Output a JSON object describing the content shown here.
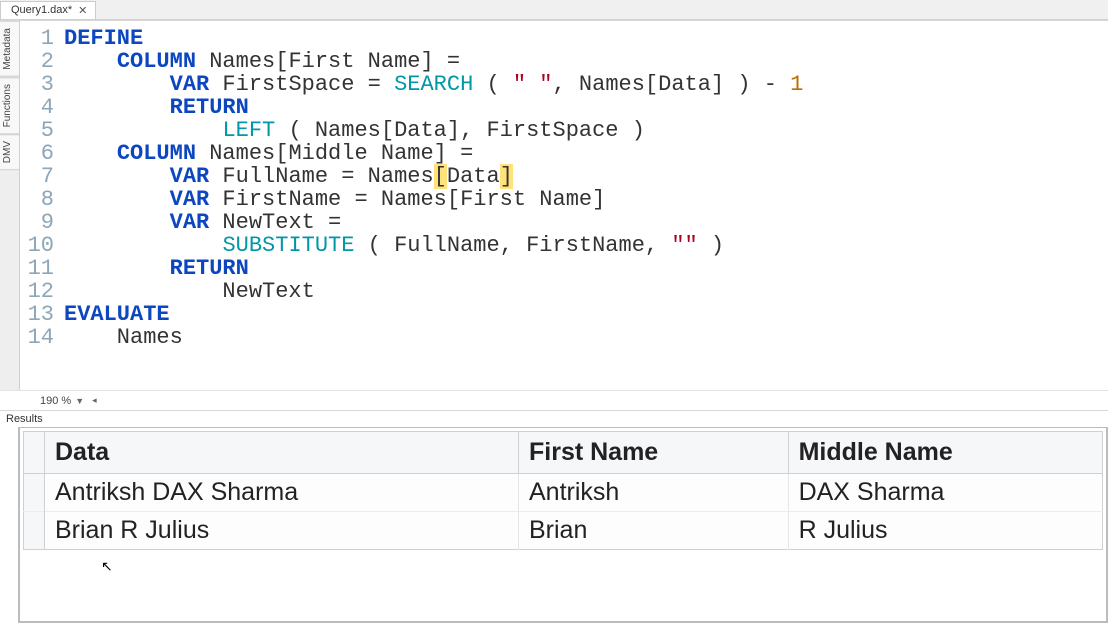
{
  "tab": {
    "label": "Query1.dax*"
  },
  "side_tabs": [
    "Metadata",
    "Functions",
    "DMV"
  ],
  "zoom": "190 %",
  "results_header": "Results",
  "code": {
    "lines": [
      {
        "n": "1",
        "seg": [
          {
            "c": "kw",
            "t": "DEFINE"
          }
        ]
      },
      {
        "n": "2",
        "seg": [
          {
            "t": "    "
          },
          {
            "c": "kw",
            "t": "COLUMN"
          },
          {
            "t": " Names[First Name] ="
          }
        ]
      },
      {
        "n": "3",
        "seg": [
          {
            "t": "        "
          },
          {
            "c": "kw",
            "t": "VAR"
          },
          {
            "t": " FirstSpace = "
          },
          {
            "c": "fn",
            "t": "SEARCH"
          },
          {
            "t": " ( "
          },
          {
            "c": "str",
            "t": "\" \""
          },
          {
            "t": ", Names[Data] ) - "
          },
          {
            "c": "num",
            "t": "1"
          }
        ]
      },
      {
        "n": "4",
        "seg": [
          {
            "t": "        "
          },
          {
            "c": "kw",
            "t": "RETURN"
          }
        ]
      },
      {
        "n": "5",
        "seg": [
          {
            "t": "            "
          },
          {
            "c": "fn",
            "t": "LEFT"
          },
          {
            "t": " ( Names[Data], FirstSpace )"
          }
        ]
      },
      {
        "n": "6",
        "seg": [
          {
            "t": "    "
          },
          {
            "c": "kw",
            "t": "COLUMN"
          },
          {
            "t": " Names[Middle Name] ="
          }
        ]
      },
      {
        "n": "7",
        "seg": [
          {
            "t": "        "
          },
          {
            "c": "kw",
            "t": "VAR"
          },
          {
            "t": " FullName = Names"
          },
          {
            "c": "hl",
            "t": "["
          },
          {
            "t": "Data"
          },
          {
            "c": "hl",
            "t": "]"
          }
        ]
      },
      {
        "n": "8",
        "seg": [
          {
            "t": "        "
          },
          {
            "c": "kw",
            "t": "VAR"
          },
          {
            "t": " FirstName = Names[First Name]"
          }
        ]
      },
      {
        "n": "9",
        "seg": [
          {
            "t": "        "
          },
          {
            "c": "kw",
            "t": "VAR"
          },
          {
            "t": " NewText ="
          }
        ]
      },
      {
        "n": "10",
        "seg": [
          {
            "t": "            "
          },
          {
            "c": "fn",
            "t": "SUBSTITUTE"
          },
          {
            "t": " ( FullName, FirstName, "
          },
          {
            "c": "str",
            "t": "\"\""
          },
          {
            "t": " )"
          }
        ]
      },
      {
        "n": "11",
        "seg": [
          {
            "t": "        "
          },
          {
            "c": "kw",
            "t": "RETURN"
          }
        ]
      },
      {
        "n": "12",
        "seg": [
          {
            "t": "            NewText"
          }
        ]
      },
      {
        "n": "13",
        "seg": [
          {
            "c": "kw",
            "t": "EVALUATE"
          }
        ]
      },
      {
        "n": "14",
        "seg": [
          {
            "t": "    Names"
          }
        ]
      }
    ]
  },
  "results": {
    "columns": [
      "Data",
      "First Name",
      "Middle Name"
    ],
    "rows": [
      [
        "Antriksh DAX Sharma",
        "Antriksh",
        "DAX Sharma"
      ],
      [
        "Brian R Julius",
        "Brian",
        "R Julius"
      ]
    ]
  }
}
